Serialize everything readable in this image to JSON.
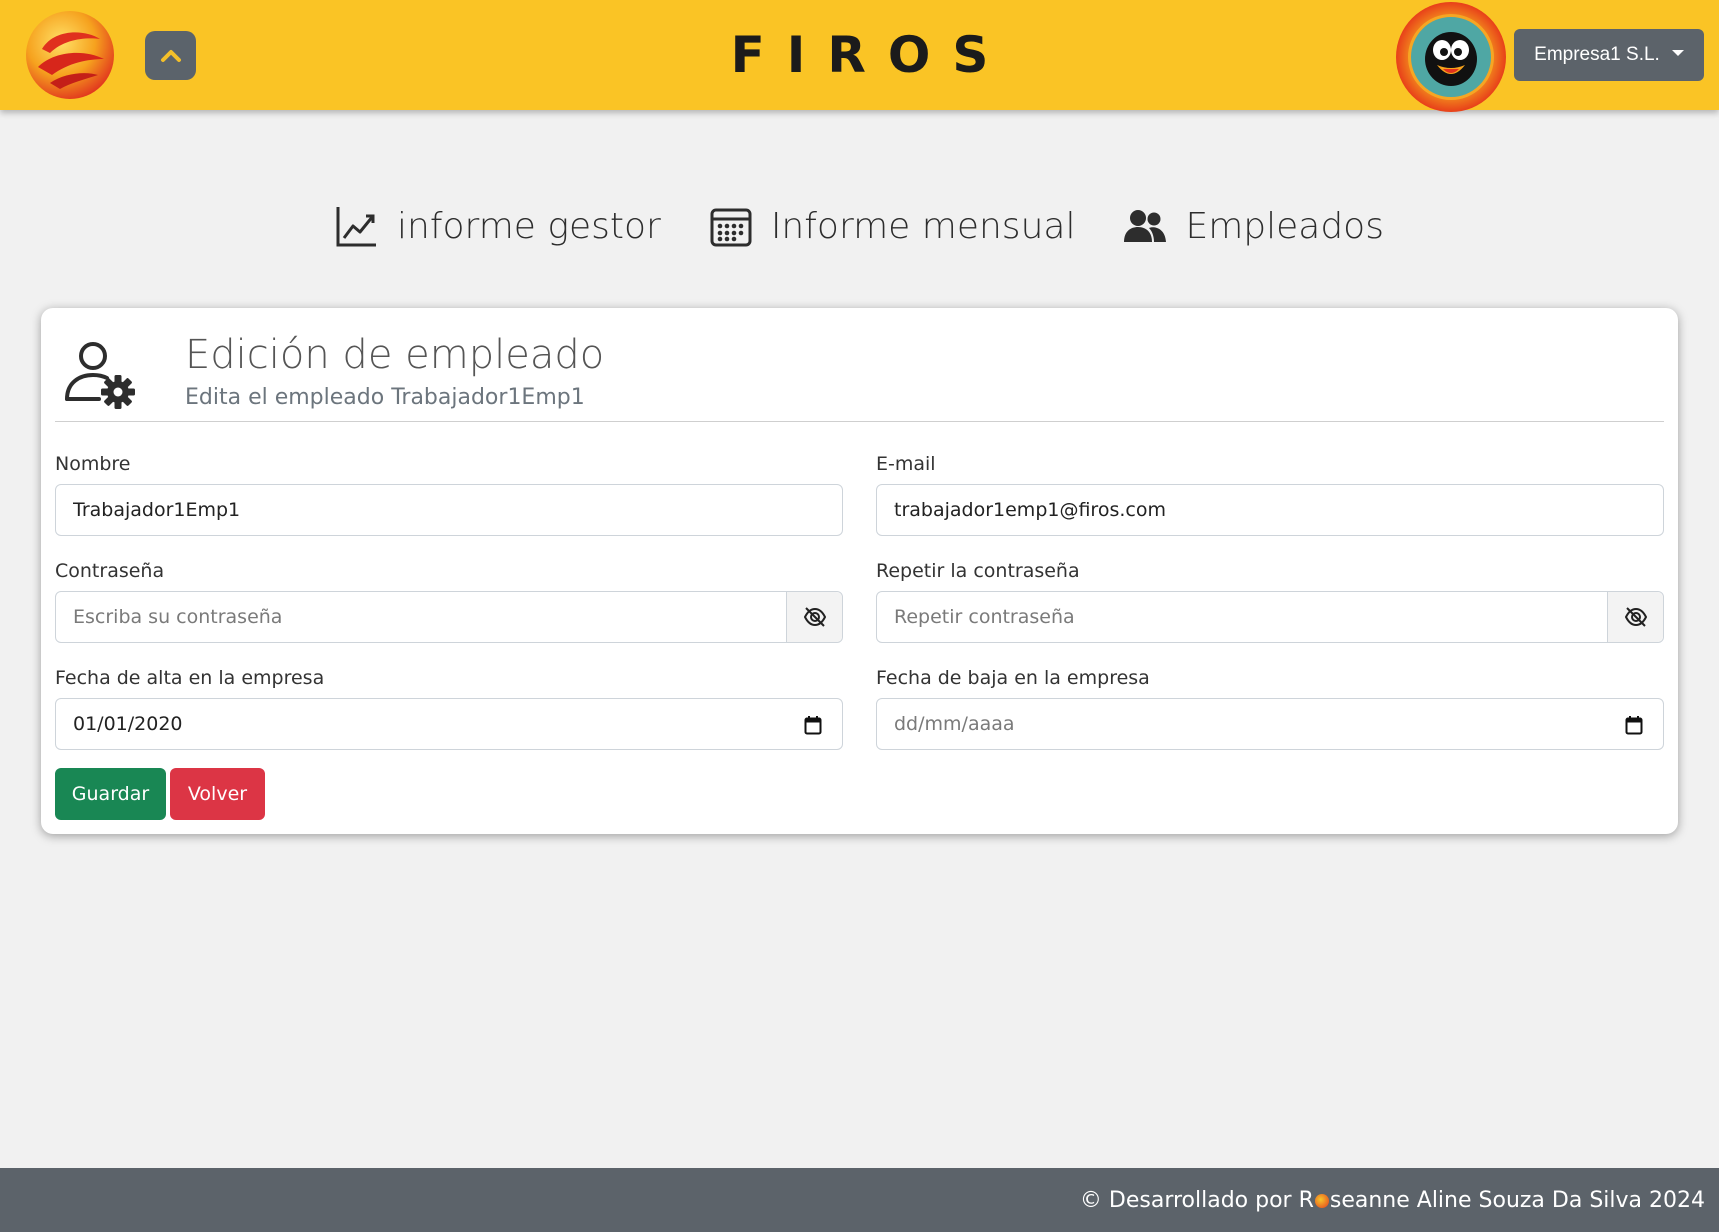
{
  "header": {
    "brand": "FIROS",
    "company_label": "Empresa1 S.L.",
    "logo_icon": "firos-flame-logo",
    "collapse_icon": "chevron-up-icon",
    "avatar_icon": "penguin-avatar"
  },
  "nav": {
    "items": [
      {
        "label": "informe gestor",
        "icon": "line-chart-icon"
      },
      {
        "label": "Informe mensual",
        "icon": "calendar-icon"
      },
      {
        "label": "Empleados",
        "icon": "users-icon"
      }
    ]
  },
  "card": {
    "title": "Edición de empleado",
    "subtitle": "Edita el empleado Trabajador1Emp1",
    "fields": {
      "nombre": {
        "label": "Nombre",
        "value": "Trabajador1Emp1"
      },
      "email": {
        "label": "E-mail",
        "value": "trabajador1emp1@firos.com"
      },
      "password": {
        "label": "Contraseña",
        "placeholder": "Escriba su contraseña"
      },
      "password_repeat": {
        "label": "Repetir la contraseña",
        "placeholder": "Repetir contraseña"
      },
      "fecha_alta": {
        "label": "Fecha de alta en la empresa",
        "value": "01/01/2020"
      },
      "fecha_baja": {
        "label": "Fecha de baja en la empresa",
        "placeholder": "dd/mm/aaaa"
      }
    },
    "buttons": {
      "save": "Guardar",
      "back": "Volver"
    }
  },
  "footer": {
    "prefix": "© Desarrollado por R",
    "suffix": "seanne Aline Souza Da Silva 2024"
  },
  "colors": {
    "header_bg": "#fac425",
    "save": "#198754",
    "back": "#dc3545",
    "footer_bg": "#5c636a"
  }
}
